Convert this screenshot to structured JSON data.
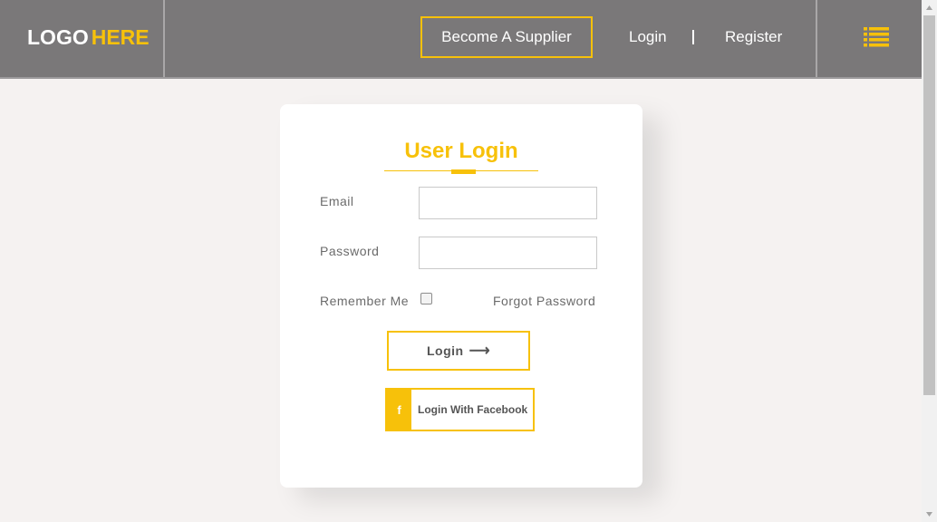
{
  "header": {
    "logo_primary": "LOGO",
    "logo_accent": "HERE",
    "supplier_button": "Become A Supplier",
    "nav_login": "Login",
    "nav_register": "Register",
    "menu_icon": "list-menu-icon"
  },
  "login_card": {
    "title": "User Login",
    "email_label": "Email",
    "email_value": "",
    "password_label": "Password",
    "password_value": "",
    "remember_label": "Remember Me",
    "remember_checked": false,
    "forgot_link": "Forgot Password",
    "login_button": "Login",
    "login_arrow": "⟶",
    "facebook_icon": "f",
    "facebook_button": "Login With Facebook"
  },
  "colors": {
    "accent": "#f7c10a",
    "header_bg": "#7a7879",
    "page_bg": "#f5f2f1",
    "card_bg": "#ffffff"
  }
}
